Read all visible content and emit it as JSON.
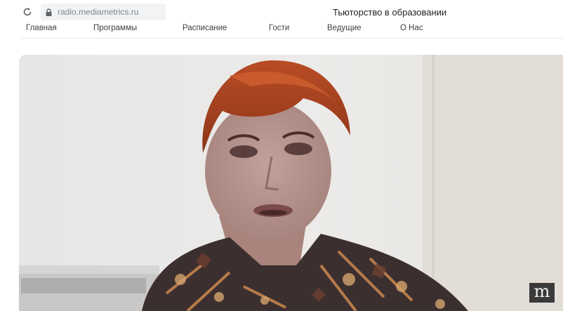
{
  "browser": {
    "url": "radio.mediametrics.ru",
    "page_title": "Тьюторство в образовании",
    "reload_icon": "reload-icon",
    "lock_icon": "lock-icon"
  },
  "nav": {
    "items": [
      {
        "label": "Главная"
      },
      {
        "label": "Программы"
      },
      {
        "label": "Расписание"
      },
      {
        "label": "Гости"
      },
      {
        "label": "Ведущие"
      },
      {
        "label": "О Нас"
      }
    ]
  },
  "video": {
    "watermark": "m",
    "colors": {
      "wall": "#e9e8e6",
      "hair": "#a1401f",
      "skin": "#b4928e",
      "blouse_dark": "#3c2f2f",
      "blouse_accent": "#b67b4a"
    }
  }
}
